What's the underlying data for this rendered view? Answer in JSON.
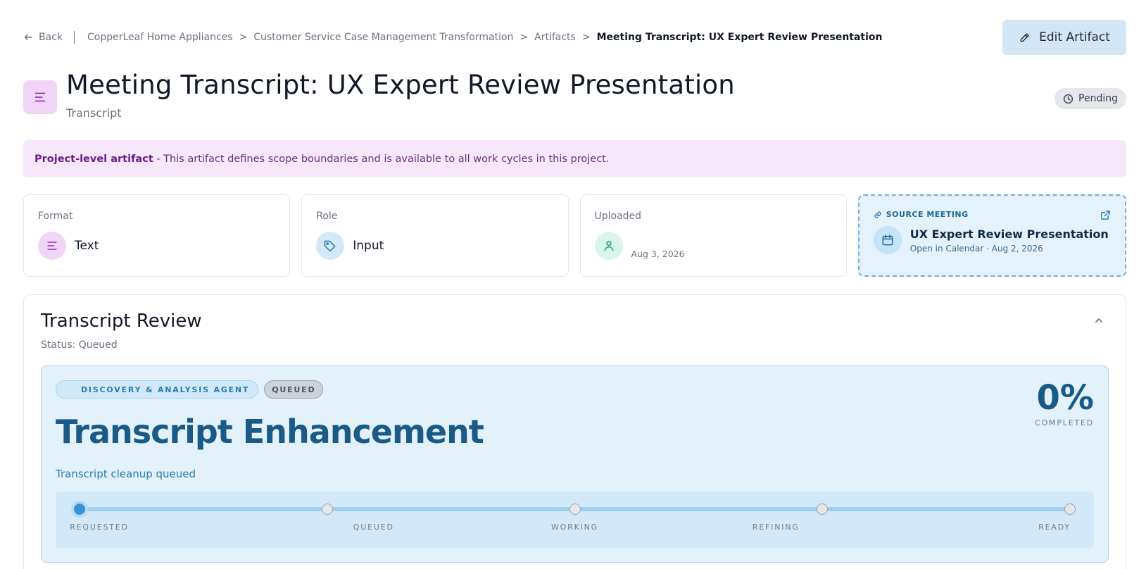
{
  "nav": {
    "back_label": "Back",
    "breadcrumbs": [
      "CopperLeaf Home Appliances",
      "Customer Service Case Management Transformation",
      "Artifacts",
      "Meeting Transcript: UX Expert Review Presentation"
    ],
    "edit_label": "Edit Artifact"
  },
  "header": {
    "title": "Meeting Transcript: UX Expert Review Presentation",
    "subtitle": "Transcript",
    "status": "Pending"
  },
  "banner": {
    "strong": "Project-level artifact",
    "text": " - This artifact defines scope boundaries and is available to all work cycles in this project."
  },
  "cards": {
    "format": {
      "label": "Format",
      "value": "Text"
    },
    "role": {
      "label": "Role",
      "value": "Input"
    },
    "uploaded": {
      "label": "Uploaded",
      "date": "Aug 3, 2026"
    },
    "source": {
      "label": "SOURCE MEETING",
      "title": "UX Expert Review Presentation",
      "subtitle": "Open in Calendar · Aug 2, 2026"
    }
  },
  "review": {
    "title": "Transcript Review",
    "status": "Status: Queued",
    "agent_tag": "DISCOVERY & ANALYSIS AGENT",
    "state_tag": "QUEUED",
    "heading": "Transcript Enhancement",
    "description": "Transcript cleanup queued",
    "percent": "0%",
    "percent_label": "COMPLETED",
    "progress": 0,
    "stages": [
      "REQUESTED",
      "QUEUED",
      "WORKING",
      "REFINING",
      "READY"
    ]
  },
  "colors": {
    "accent": "#1a5a86",
    "banner_bg": "#f6e7fb",
    "edit_bg": "#d3e6f5"
  }
}
